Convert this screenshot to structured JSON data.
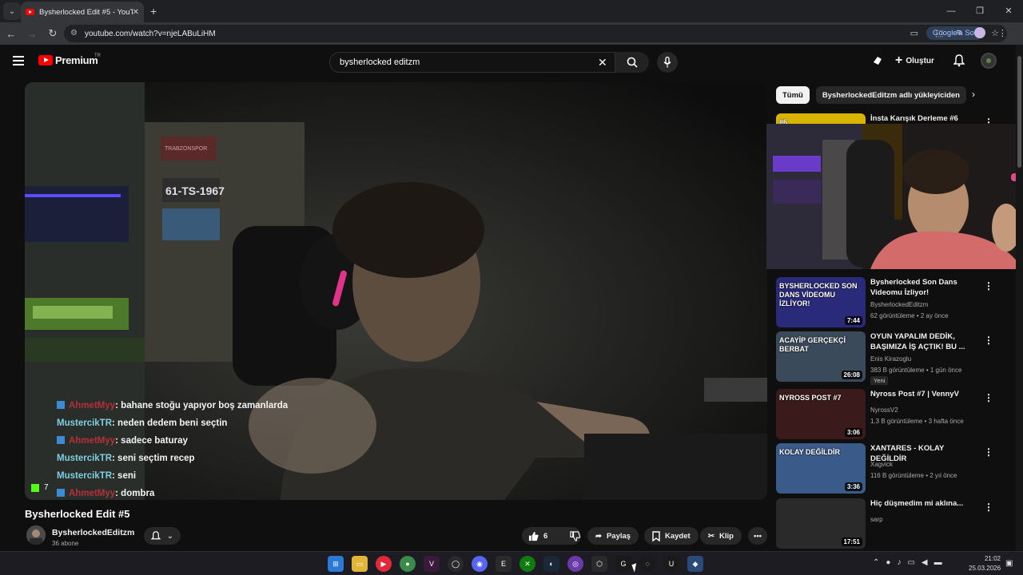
{
  "browser": {
    "tab_title": "Bysherlocked Edit #5 - YouTube",
    "url": "youtube.com/watch?v=njeLABuLiHM",
    "google_sor": "Google'a Sor"
  },
  "header": {
    "logo": "Premium",
    "logo_region": "TR",
    "search_value": "bysherlocked editzm",
    "create_label": "Oluştur"
  },
  "video": {
    "chat": [
      {
        "user": "AhmetMyy",
        "message": ": bahane stoğu yapıyor boş zamanlarda",
        "color": "#b3303a",
        "badge": true
      },
      {
        "user": "MustercikTR",
        "message": ": neden dedem beni seçtin",
        "color": "#7fcfe0",
        "badge": false
      },
      {
        "user": "AhmetMyy",
        "message": ": sadece baturay",
        "color": "#b3303a",
        "badge": true
      },
      {
        "user": "MustercikTR",
        "message": ": seni seçtim recep",
        "color": "#7fcfe0",
        "badge": false
      },
      {
        "user": "MustercikTR",
        "message": ": seni",
        "color": "#7fcfe0",
        "badge": false
      },
      {
        "user": "AhmetMyy",
        "message": ": dombra",
        "color": "#b3303a",
        "badge": true
      }
    ],
    "viewers": "7",
    "wall_text": "61-TS-1967",
    "wall_brand": "TRABZONSPOR"
  },
  "meta": {
    "title": "Bysherlocked Edit #5",
    "channel": "BysherlockedEditzm",
    "subs": "36 abone",
    "likes": "6",
    "share": "Paylaş",
    "save": "Kaydet",
    "clip": "Klip"
  },
  "sidebar": {
    "chips": [
      "Tümü",
      "BysherlockedEditzm adlı yükleyiciden"
    ],
    "recs": [
      {
        "title": "İnsta Karışık Derleme #6",
        "channel": "",
        "meta": "",
        "duration": "",
        "new": "",
        "thumb_text": "#6"
      },
      {
        "title": "Bysherlocked Son Dans Videomu İzliyor!",
        "channel": "BysherlockedEditzm",
        "meta": "62 görüntüleme • 2 ay önce",
        "duration": "7:44",
        "new": "",
        "thumb_text": "BYSHERLOCKED SON DANS VİDEOMU İZLİYOR!"
      },
      {
        "title": "OYUN YAPALIM DEDİK, BAŞIMIZA İŞ AÇTIK! BU ...",
        "channel": "Enis Kirazoglu",
        "meta": "383 B görüntüleme • 1 gün önce",
        "duration": "26:08",
        "new": "Yeni",
        "thumb_text": "ACAYİP GERÇEKÇİ BERBAT"
      },
      {
        "title": "Nyross Post #7 | VennyV",
        "channel": "NyrossV2",
        "meta": "1,3 B görüntüleme • 3 hafta önce",
        "duration": "3:06",
        "new": "",
        "thumb_text": "NYROSS POST #7"
      },
      {
        "title": "XANTARES - KOLAY DEĞİLDİR",
        "channel": "Xagvick",
        "meta": "116 B görüntüleme • 2 yıl önce",
        "duration": "3:36",
        "new": "",
        "thumb_text": "KOLAY DEĞİLDİR"
      },
      {
        "title": "Hiç düşmedim mi aklına...",
        "channel": "sarp",
        "meta": "",
        "duration": "17:51",
        "new": "",
        "thumb_text": ""
      }
    ]
  },
  "taskbar": {
    "time": "21:02",
    "date": "25.03.2026"
  },
  "colors": {
    "yt_red": "#ff0000",
    "bg": "#0f0f0f",
    "pill_bg": "#272727"
  }
}
